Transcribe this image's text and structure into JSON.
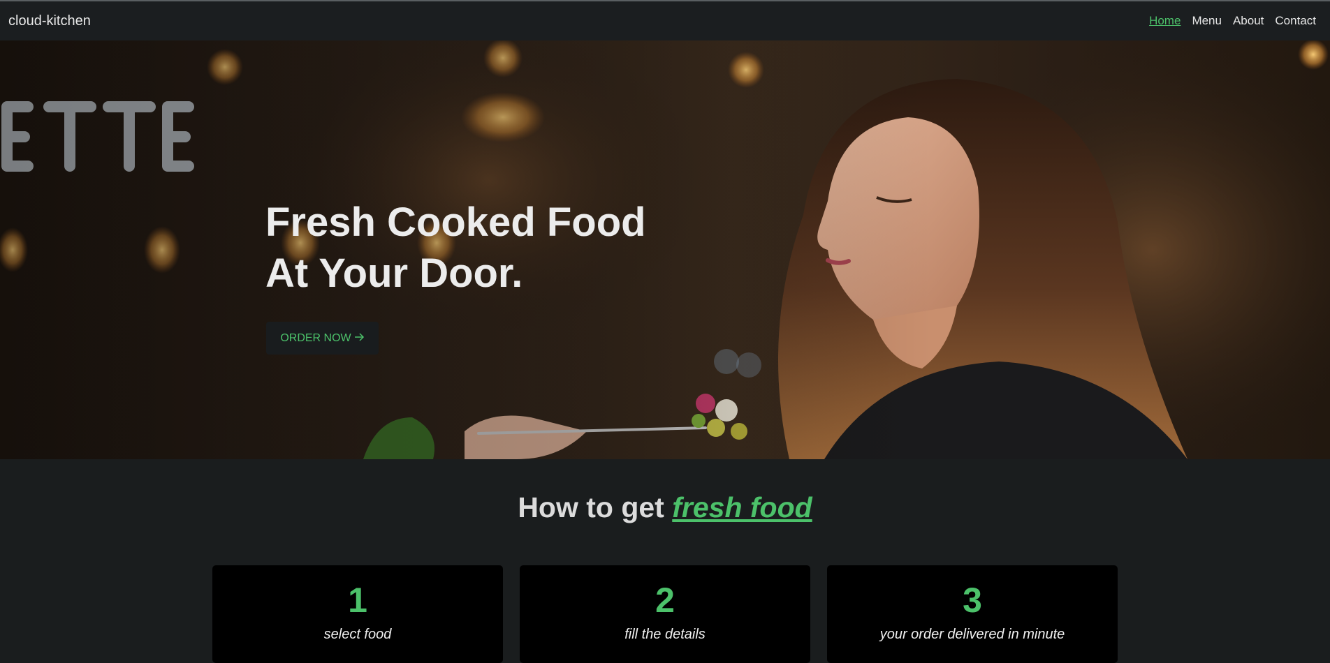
{
  "navbar": {
    "brand": "cloud-kitchen",
    "links": [
      {
        "label": "Home",
        "active": true
      },
      {
        "label": "Menu",
        "active": false
      },
      {
        "label": "About",
        "active": false
      },
      {
        "label": "Contact",
        "active": false
      }
    ]
  },
  "hero": {
    "title_line1": "Fresh Cooked Food",
    "title_line2": "At Your Door.",
    "button_label": "ORDER NOW",
    "button_icon": "arrow-right-icon"
  },
  "how": {
    "prefix": "How to get ",
    "highlight": "fresh food"
  },
  "steps": [
    {
      "number": "1",
      "text": "select food"
    },
    {
      "number": "2",
      "text": "fill the details"
    },
    {
      "number": "3",
      "text": "your order delivered in minute"
    }
  ],
  "colors": {
    "accent": "#4cc16a",
    "background": "#1a1d1e",
    "card": "#000000"
  }
}
